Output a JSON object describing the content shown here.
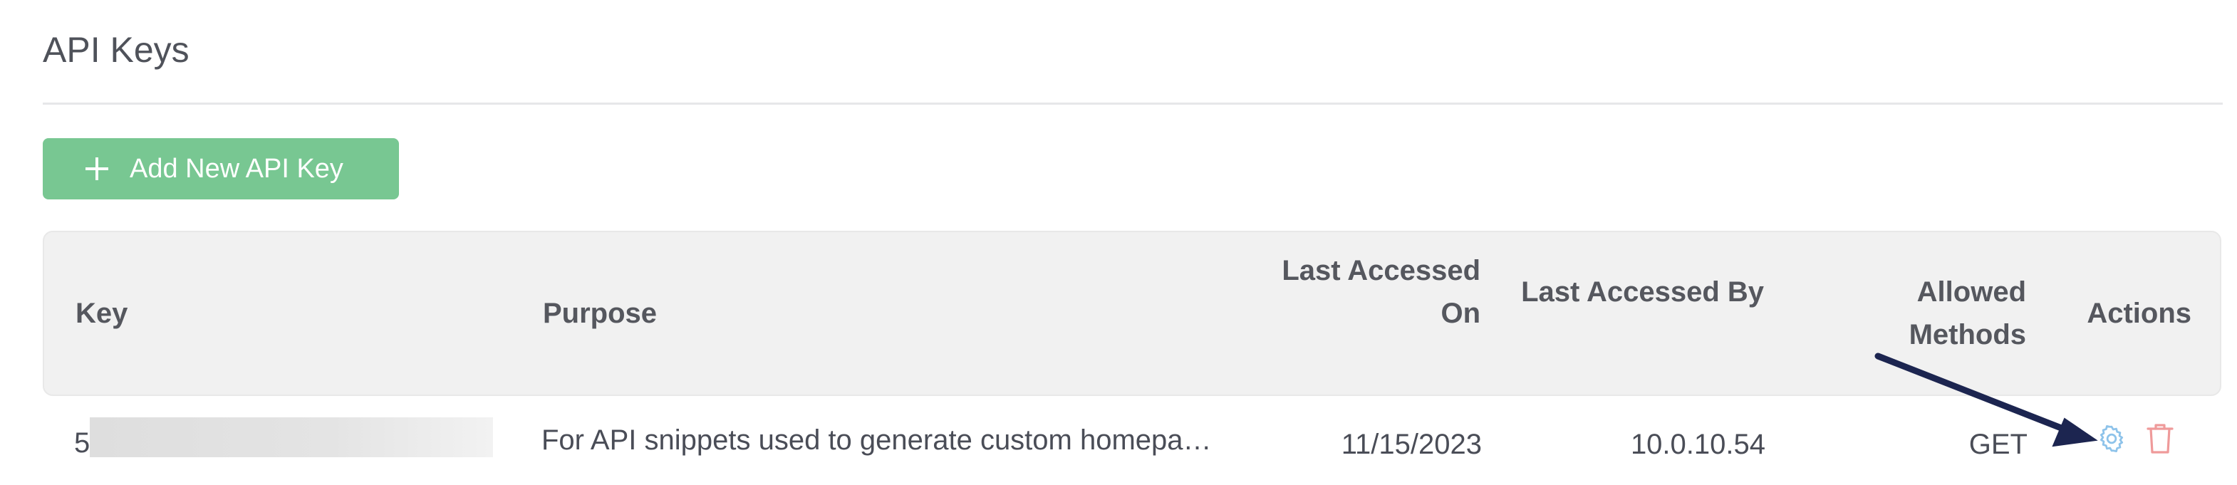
{
  "page": {
    "title": "API Keys"
  },
  "toolbar": {
    "add_label": "Add New API Key"
  },
  "table": {
    "headers": {
      "key": "Key",
      "purpose": "Purpose",
      "last_accessed_on": "Last Accessed On",
      "last_accessed_by": "Last Accessed By",
      "allowed_methods": "Allowed Methods",
      "actions": "Actions"
    },
    "rows": [
      {
        "key": "5",
        "purpose": "For API snippets used to generate custom homepa…",
        "last_accessed_on": "11/15/2023",
        "last_accessed_by": "10.0.10.54",
        "allowed_methods": "GET"
      }
    ]
  },
  "icons": {
    "settings": "gear-icon",
    "delete": "trash-icon",
    "add": "plus-icon"
  },
  "colors": {
    "primary_button": "#78c792",
    "settings_icon": "#8ec3ea",
    "delete_icon": "#ef9a9a",
    "annotation_arrow": "#1c2550"
  }
}
